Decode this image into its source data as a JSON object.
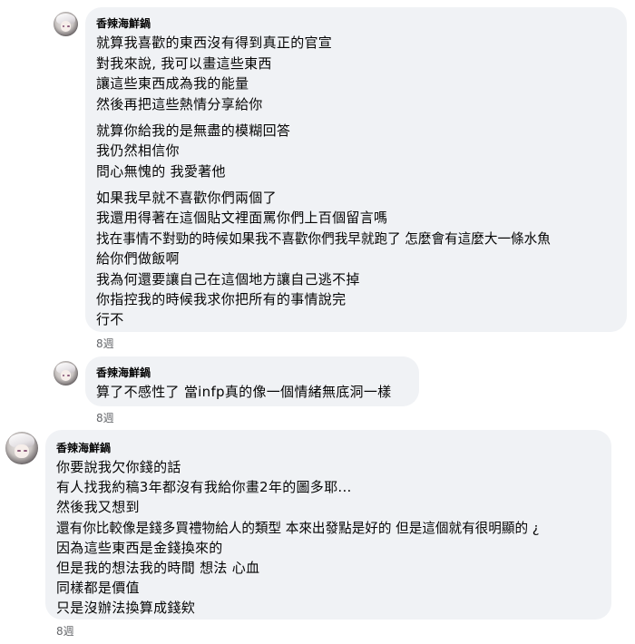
{
  "comments": [
    {
      "author": "香辣海鮮鍋",
      "lines": [
        "就算我喜歡的東西沒有得到真正的官宣",
        "對我來說, 我可以畫這些東西",
        "讓這些東西成為我的能量",
        "然後再把這些熱情分享給你",
        "就算你給我的是無盡的模糊回答",
        "我仍然相信你",
        "問心無愧的 我愛著他",
        "如果我早就不喜歡你們兩個了",
        "我還用得著在這個貼文裡面罵你們上百個留言嗎",
        "找在事情不對勁的時候如果我不喜歡你們我早就跑了 怎麼會有這麼大一條水魚",
        "給你們做飯啊",
        "我為何還要讓自己在這個地方讓自己逃不掉",
        "你指控我的時候我求你把所有的事情說完",
        "行不"
      ],
      "time": "8週"
    },
    {
      "author": "香辣海鮮鍋",
      "lines": [
        "算了不感性了 當infp真的像一個情緒無底洞一樣"
      ],
      "time": "8週"
    },
    {
      "author": "香辣海鮮鍋",
      "lines": [
        "你要說我欠你錢的話",
        "有人找我約稿3年都沒有我給你畫2年的圖多耶...",
        "然後我又想到",
        "還有你比較像是錢多買禮物給人的類型 本來出發點是好的 但是這個就有很明顯的 ¿",
        "因為這些東西是金錢換來的",
        "但是我的想法我的時間 想法 心血",
        "同樣都是價值",
        "只是沒辦法換算成錢欸"
      ],
      "time": "8週"
    }
  ]
}
